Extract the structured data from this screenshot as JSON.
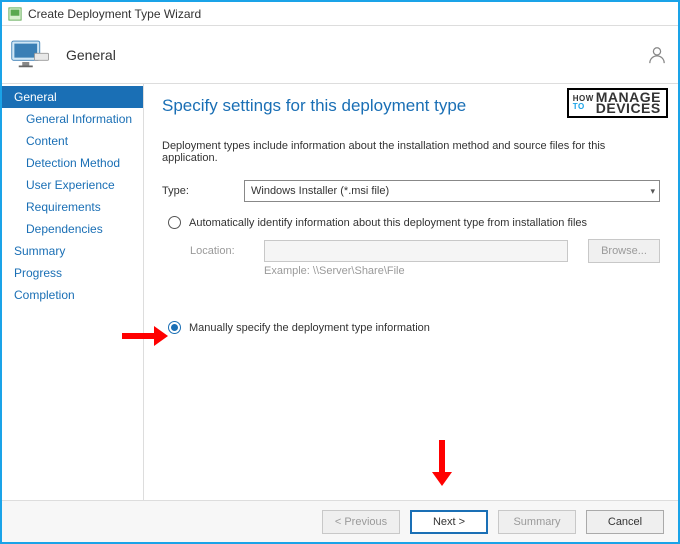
{
  "window": {
    "title": "Create Deployment Type Wizard"
  },
  "header": {
    "title": "General"
  },
  "sidebar": {
    "items": [
      {
        "label": "General",
        "selected": true,
        "sub": false
      },
      {
        "label": "General Information",
        "selected": false,
        "sub": true
      },
      {
        "label": "Content",
        "selected": false,
        "sub": true
      },
      {
        "label": "Detection Method",
        "selected": false,
        "sub": true
      },
      {
        "label": "User Experience",
        "selected": false,
        "sub": true
      },
      {
        "label": "Requirements",
        "selected": false,
        "sub": true
      },
      {
        "label": "Dependencies",
        "selected": false,
        "sub": true
      },
      {
        "label": "Summary",
        "selected": false,
        "sub": false
      },
      {
        "label": "Progress",
        "selected": false,
        "sub": false
      },
      {
        "label": "Completion",
        "selected": false,
        "sub": false
      }
    ]
  },
  "main": {
    "heading": "Specify settings for this deployment type",
    "description": "Deployment types include information about the installation method and source files for this application.",
    "type_label": "Type:",
    "type_value": "Windows Installer (*.msi file)",
    "radio_auto": "Automatically identify information about this deployment type from installation files",
    "location_label": "Location:",
    "browse_label": "Browse...",
    "example_label": "Example: \\\\Server\\Share\\File",
    "radio_manual": "Manually specify the deployment type information"
  },
  "footer": {
    "previous": "< Previous",
    "next": "Next >",
    "summary": "Summary",
    "cancel": "Cancel"
  },
  "watermark": {
    "how": "HOW",
    "to": "TO",
    "manage": "MANAGE",
    "devices": "DEVICES"
  }
}
